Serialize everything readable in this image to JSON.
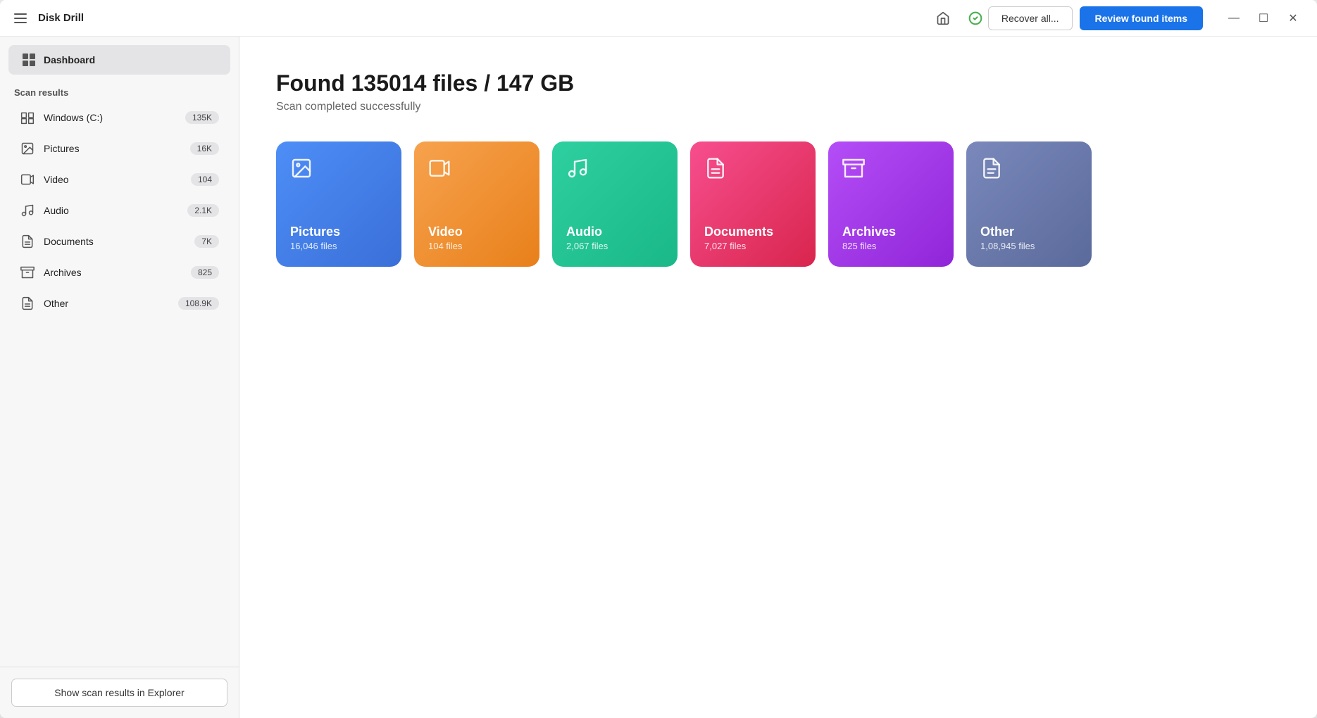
{
  "app": {
    "title": "Disk Drill"
  },
  "titlebar": {
    "recover_label": "Recover all...",
    "review_label": "Review found items"
  },
  "window_controls": {
    "minimize": "—",
    "maximize": "☐",
    "close": "✕"
  },
  "sidebar": {
    "dashboard_label": "Dashboard",
    "scan_results_label": "Scan results",
    "items": [
      {
        "id": "windows",
        "label": "Windows (C:)",
        "badge": "135K"
      },
      {
        "id": "pictures",
        "label": "Pictures",
        "badge": "16K"
      },
      {
        "id": "video",
        "label": "Video",
        "badge": "104"
      },
      {
        "id": "audio",
        "label": "Audio",
        "badge": "2.1K"
      },
      {
        "id": "documents",
        "label": "Documents",
        "badge": "7K"
      },
      {
        "id": "archives",
        "label": "Archives",
        "badge": "825"
      },
      {
        "id": "other",
        "label": "Other",
        "badge": "108.9K"
      }
    ],
    "footer_btn": "Show scan results in Explorer"
  },
  "main": {
    "found_title": "Found 135014 files / 147 GB",
    "scan_status": "Scan completed successfully",
    "cards": [
      {
        "id": "pictures",
        "label": "Pictures",
        "count": "16,046 files",
        "color_class": "card-pictures"
      },
      {
        "id": "video",
        "label": "Video",
        "count": "104 files",
        "color_class": "card-video"
      },
      {
        "id": "audio",
        "label": "Audio",
        "count": "2,067 files",
        "color_class": "card-audio"
      },
      {
        "id": "documents",
        "label": "Documents",
        "count": "7,027 files",
        "color_class": "card-documents"
      },
      {
        "id": "archives",
        "label": "Archives",
        "count": "825 files",
        "color_class": "card-archives"
      },
      {
        "id": "other",
        "label": "Other",
        "count": "1,08,945 files",
        "color_class": "card-other"
      }
    ]
  }
}
